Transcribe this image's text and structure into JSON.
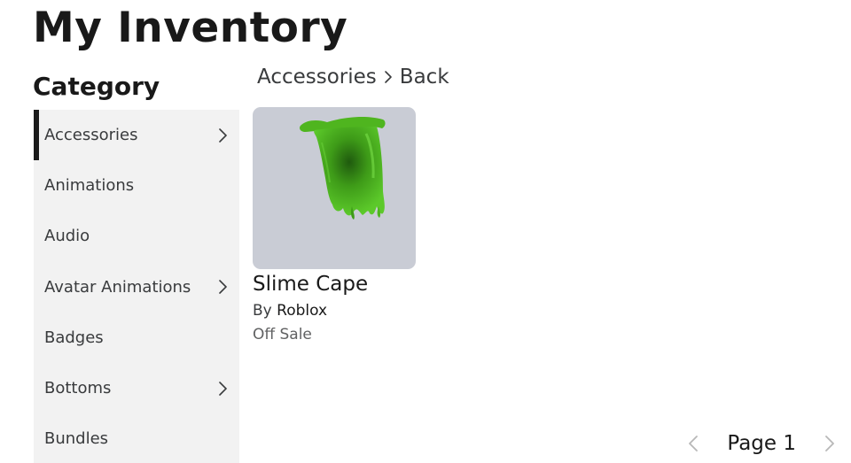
{
  "page": {
    "title": "My Inventory"
  },
  "sidebar": {
    "heading": "Category",
    "items": [
      {
        "label": "Accessories",
        "has_submenu": true,
        "active": true
      },
      {
        "label": "Animations",
        "has_submenu": false,
        "active": false
      },
      {
        "label": "Audio",
        "has_submenu": false,
        "active": false
      },
      {
        "label": "Avatar Animations",
        "has_submenu": true,
        "active": false
      },
      {
        "label": "Badges",
        "has_submenu": false,
        "active": false
      },
      {
        "label": "Bottoms",
        "has_submenu": true,
        "active": false
      },
      {
        "label": "Bundles",
        "has_submenu": false,
        "active": false
      }
    ]
  },
  "breadcrumb": {
    "current": "Accessories",
    "back": "Back"
  },
  "items": [
    {
      "name": "Slime Cape",
      "by_prefix": "By",
      "creator": "Roblox",
      "price": "Off Sale",
      "thumb_bg": "#c9ccd5",
      "icon": "slime-cape-image"
    }
  ],
  "pagination": {
    "label": "Page 1"
  },
  "colors": {
    "sidebar_bg": "#f2f2f2",
    "active_indicator": "#1b1b1b",
    "text_primary": "#191919",
    "text_secondary": "#393b3d"
  }
}
